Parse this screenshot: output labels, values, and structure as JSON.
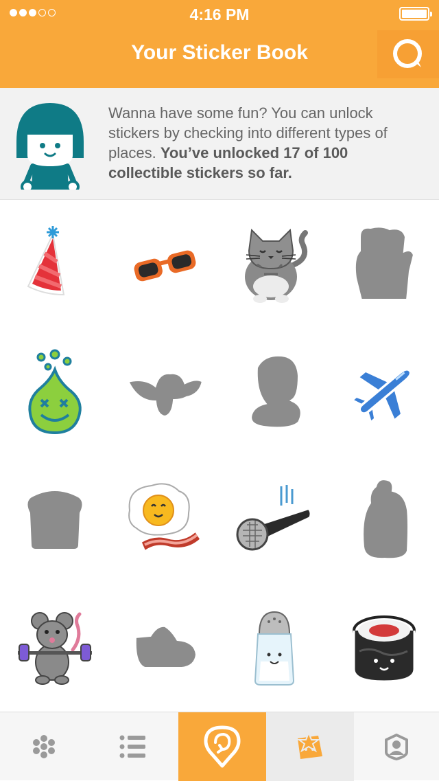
{
  "status_bar": {
    "time": "4:16 PM",
    "signal_dots_filled": 3,
    "signal_dots_total": 5,
    "battery_level": 1.0
  },
  "header": {
    "title": "Your Sticker Book",
    "search_icon": "search-icon",
    "bg_color": "#f9a83a"
  },
  "intro": {
    "text_plain": "Wanna have some fun? You can unlock stickers by checking into different types of places. ",
    "text_bold": "You’ve unlocked 17 of 100 collectible stickers so far."
  },
  "stickers": [
    {
      "name": "party-hat",
      "locked": false
    },
    {
      "name": "sunglasses",
      "locked": false
    },
    {
      "name": "cat",
      "locked": false
    },
    {
      "name": "locked-sticker",
      "locked": true
    },
    {
      "name": "slime-smiley",
      "locked": false
    },
    {
      "name": "locked-sticker",
      "locked": true
    },
    {
      "name": "locked-sticker",
      "locked": true
    },
    {
      "name": "airplane",
      "locked": false
    },
    {
      "name": "locked-toast",
      "locked": true
    },
    {
      "name": "egg-and-bacon",
      "locked": false
    },
    {
      "name": "microphone",
      "locked": false
    },
    {
      "name": "locked-sticker",
      "locked": true
    },
    {
      "name": "weightlifting-mouse",
      "locked": false
    },
    {
      "name": "locked-sticker",
      "locked": true
    },
    {
      "name": "salt-shaker",
      "locked": false
    },
    {
      "name": "sushi-roll",
      "locked": false
    }
  ],
  "tabbar": {
    "tabs": [
      {
        "icon": "grid-dots-icon",
        "state": "normal"
      },
      {
        "icon": "list-icon",
        "state": "normal"
      },
      {
        "icon": "check-in-icon",
        "state": "accent"
      },
      {
        "icon": "sticker-book-icon",
        "state": "selected"
      },
      {
        "icon": "profile-icon",
        "state": "normal"
      }
    ]
  },
  "colors": {
    "accent": "#f9a83a",
    "locked_gray": "#8c8c8c",
    "banner_bg": "#f2f2f2"
  }
}
